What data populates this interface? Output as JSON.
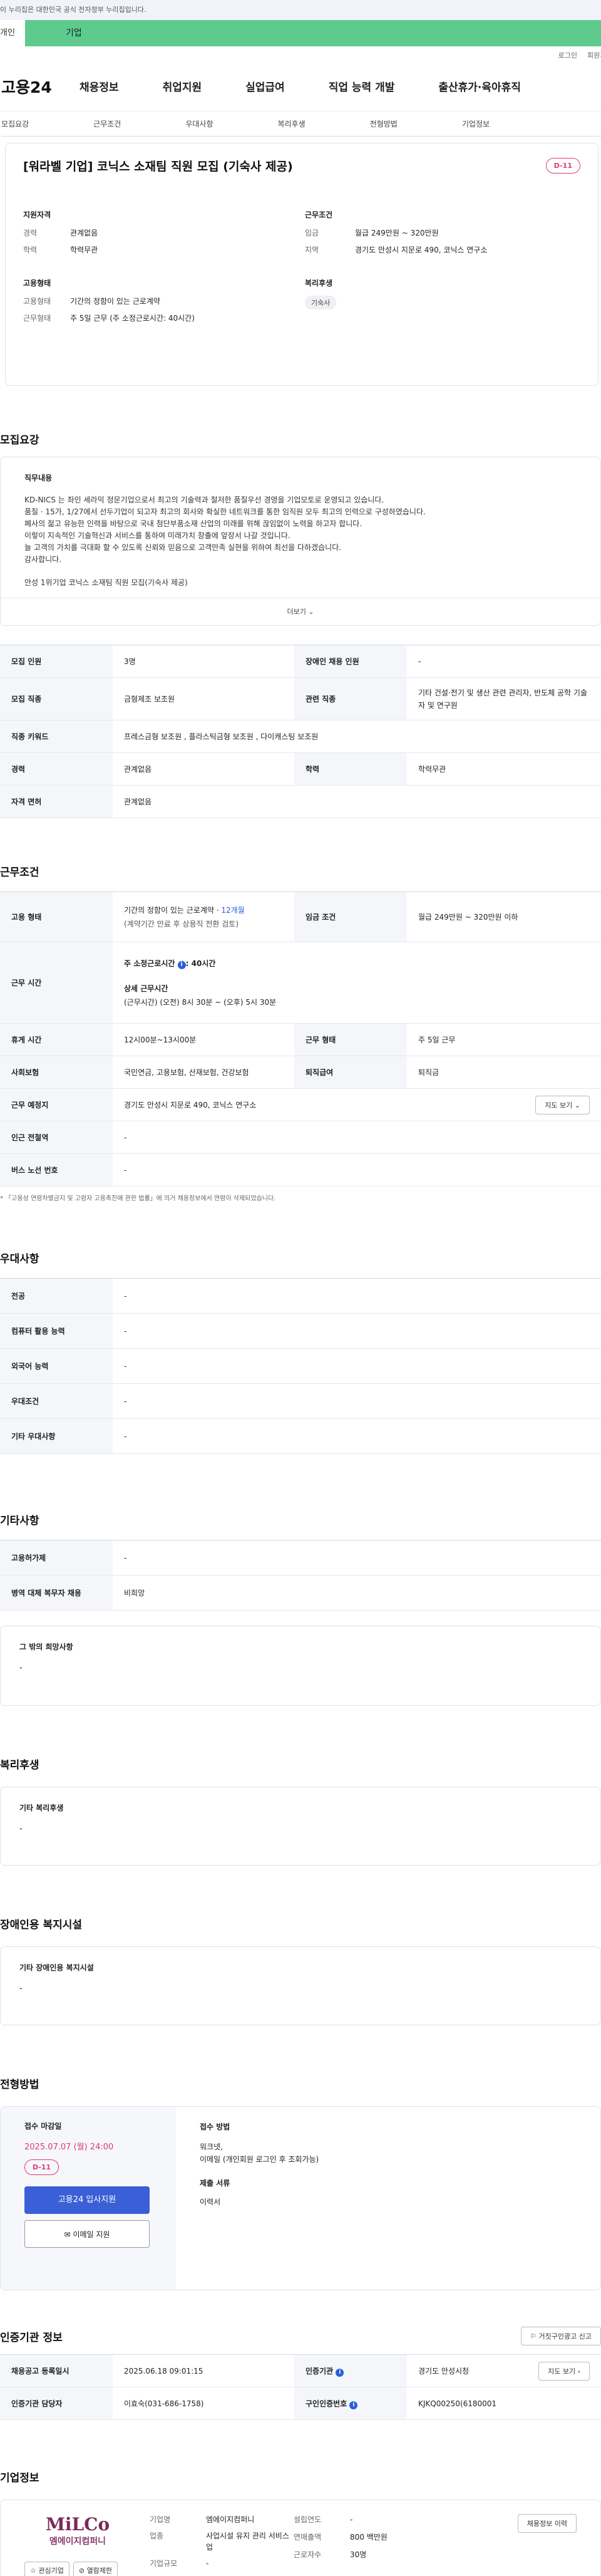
{
  "gov_banner": "이 누리집은 대한민국 공식 전자정부 누리집입니다.",
  "tabs": {
    "first": "개인",
    "second": "기업"
  },
  "utils": {
    "login": "로그인",
    "join": "회원가입"
  },
  "logo": "고용24",
  "gnb": [
    "채용정보",
    "취업지원",
    "실업급여",
    "직업 능력 개발",
    "출산휴가·육아휴직"
  ],
  "subnav": [
    "모집요강",
    "근무조건",
    "우대사항",
    "복리후생",
    "전형방법",
    "기업정보"
  ],
  "header": {
    "title": "[워라벨 기업] 코닉스 소재팀 직원 모집 (기숙사 제공)",
    "dday": "D-11"
  },
  "summary": {
    "qual_title": "지원자격",
    "qual": [
      {
        "k": "경력",
        "v": "관계없음"
      },
      {
        "k": "학력",
        "v": "학력무관"
      }
    ],
    "work_title": "근무조건",
    "work": [
      {
        "k": "임금",
        "v": "월급 249만원 ~ 320만원"
      },
      {
        "k": "지역",
        "v": "경기도 안성시 지문로 490, 코닉스 연구소"
      }
    ],
    "emp_title": "고용형태",
    "emp": [
      {
        "k": "고용형태",
        "v": "기간의 정함이 있는 근로계약"
      },
      {
        "k": "근무형태",
        "v": "주 5일 근무 (주 소정근로시간: 40시간)"
      }
    ],
    "welfare_title": "복리후생",
    "welfare_tag": "기숙사"
  },
  "recruit": {
    "title": "모집요강",
    "job_label": "직무내용",
    "desc": [
      "KD-NICS 는 좌인 세라믹 정문기업으로서 최고의 기술력과 철저한 품질우선 경영을 기업모토로 운영되고 있습니다.",
      "품질 · 15가, 1/27에서 선두기업이 되고자 최고의 회사와 확실한 네트워크를 통한 임직원 모두 최고의 인력으로 구성하였습니다.",
      "폐사의 젊고 유능한 인력을 바탕으로 국내 첨단부품소재 산업의 미래를 위해 끊임없이 노력을 하고자 합니다.",
      "이렇이 지속적인 기술혁신과 서비스를 통하여 미래가치 창출에 앞장서 나갈 것입니다.",
      "늘 고객의 가치를 극대화 할 수 있도록 신뢰와 믿음으로 고객만족 실현을 위하여 최선을 다하겠습니다.",
      "감사합니다."
    ],
    "desc_extra": "안성 1위기업 코닉스  소재팀 직원 모집(기숙사 제공)",
    "more": "더보기",
    "rows": [
      {
        "k": "모집 인원",
        "v": "3명",
        "k2": "장애인 채용 인원",
        "v2": "-"
      },
      {
        "k": "모집 직종",
        "v": "금형제조 보조원",
        "k2": "관련 직종",
        "v2": "기타 건설·전기 및 생산 관련 관리자, 반도체 공학 기술자 및 연구원"
      },
      {
        "k": "직종 키워드",
        "v": "프레스금형 보조원 , 플라스틱금형 보조원 , 다이캐스팅 보조원"
      },
      {
        "k": "경력",
        "v": "관계없음",
        "k2": "학력",
        "v2": "학력무관"
      },
      {
        "k": "자격 면허",
        "v": "관계없음"
      }
    ]
  },
  "conditions": {
    "title": "근무조건",
    "emp_type_k": "고용 형태",
    "emp_type_v": "기간의 정함이 있는 근로계약 · ",
    "emp_type_link": "12개월",
    "emp_type_sub": "(계약기간 만료 후 상용직 전환 검토)",
    "wage_k": "임금 조건",
    "wage_v": "월급 249만원 ~ 320만원 이하",
    "hours_k": "근무 시간",
    "hours_main": "주 소정근로시간",
    "hours_val": ": 40시간",
    "hours_detail_label": "상세 근무시간",
    "hours_detail": "(근무시간) (오전) 8시 30분 ~ (오후) 5시 30분",
    "rows": [
      {
        "k": "휴게 시간",
        "v": "12시00분~13시00분",
        "k2": "근무 형태",
        "v2": "주 5일 근무"
      },
      {
        "k": "사회보험",
        "v": "국민연금, 고용보험, 산재보험, 건강보험",
        "k2": "퇴직급여",
        "v2": "퇴직금"
      }
    ],
    "place_k": "근무 예정지",
    "place_v": "경기도 안성시 지문로 490, 코닉스 연구소",
    "map_btn": "지도 보기",
    "subway_k": "인근 전철역",
    "subway_v": "-",
    "bus_k": "버스 노선 번호",
    "bus_v": "-",
    "note": "* 「고용상 연령차별금지 및 고령자 고용촉진에 관한 법률」에 의거 채용정보에서 연령이 삭제되었습니다."
  },
  "pref": {
    "title": "우대사항",
    "rows": [
      {
        "k": "전공",
        "v": "-"
      },
      {
        "k": "컴퓨터 활용 능력",
        "v": "-"
      },
      {
        "k": "외국어 능력",
        "v": "-"
      },
      {
        "k": "우대조건",
        "v": "-"
      },
      {
        "k": "기타 우대사항",
        "v": "-"
      }
    ]
  },
  "other": {
    "title": "기타사항",
    "rows": [
      {
        "k": "고용허가제",
        "v": "-"
      },
      {
        "k": "병역 대체 복무자 채용",
        "v": "비희망"
      }
    ],
    "box_label": "그 밖의 희망사항",
    "box_value": "-"
  },
  "welfare": {
    "title": "복리후생",
    "box_label": "기타 복리후생",
    "box_value": "-"
  },
  "disability": {
    "title": "장애인용 복지시설",
    "box_label": "기타 장애인용 복지시설",
    "box_value": "-"
  },
  "selection": {
    "title": "전형방법",
    "deadline_label": "접수 마감일",
    "deadline": "2025.07.07 (월) 24:00",
    "dday": "D-11",
    "apply_btn": "고용24 입사지원",
    "email_btn": "이메일 지원",
    "method_label": "접수 방법",
    "method": "워크넷,",
    "method2": "이메일 (개인회원 로그인 후 조회가능)",
    "docs_label": "제출 서류",
    "docs": "이력서"
  },
  "cert": {
    "title": "인증기관 정보",
    "report_btn": "거짓구인광고 신고",
    "rows": [
      {
        "k": "채용공고 등록일시",
        "v": "2025.06.18 09:01:15",
        "k2": "인증기관",
        "v2": "경기도 안성시청",
        "btn": "지도 보기"
      },
      {
        "k": "인증기관 담당자",
        "v": "이효숙(031-686-1758)",
        "k2": "구인인증번호",
        "v2": "KJKQ00250(6180001"
      }
    ]
  },
  "company": {
    "title": "기업정보",
    "logo_text": "MiLCo",
    "logo_sub": "엠에이지컴퍼니",
    "interest": "관심기업",
    "view": "열람제한",
    "fields": [
      {
        "k": "기업명",
        "v": "엠에이지컴퍼니"
      },
      {
        "k": "업종",
        "v": "사업시설 유지 관리 서비스업"
      },
      {
        "k": "기업규모",
        "v": "-"
      }
    ],
    "fields2": [
      {
        "k": "설립연도",
        "v": "-"
      },
      {
        "k": "연매출액",
        "v": "800 백만원"
      },
      {
        "k": "근로자수",
        "v": "30명"
      }
    ],
    "jobs_btn": "채용정보 이력"
  },
  "colors": {
    "accent": "#2b5fd9",
    "dday": "#e03b6f",
    "tab": "#5ecb8d"
  }
}
